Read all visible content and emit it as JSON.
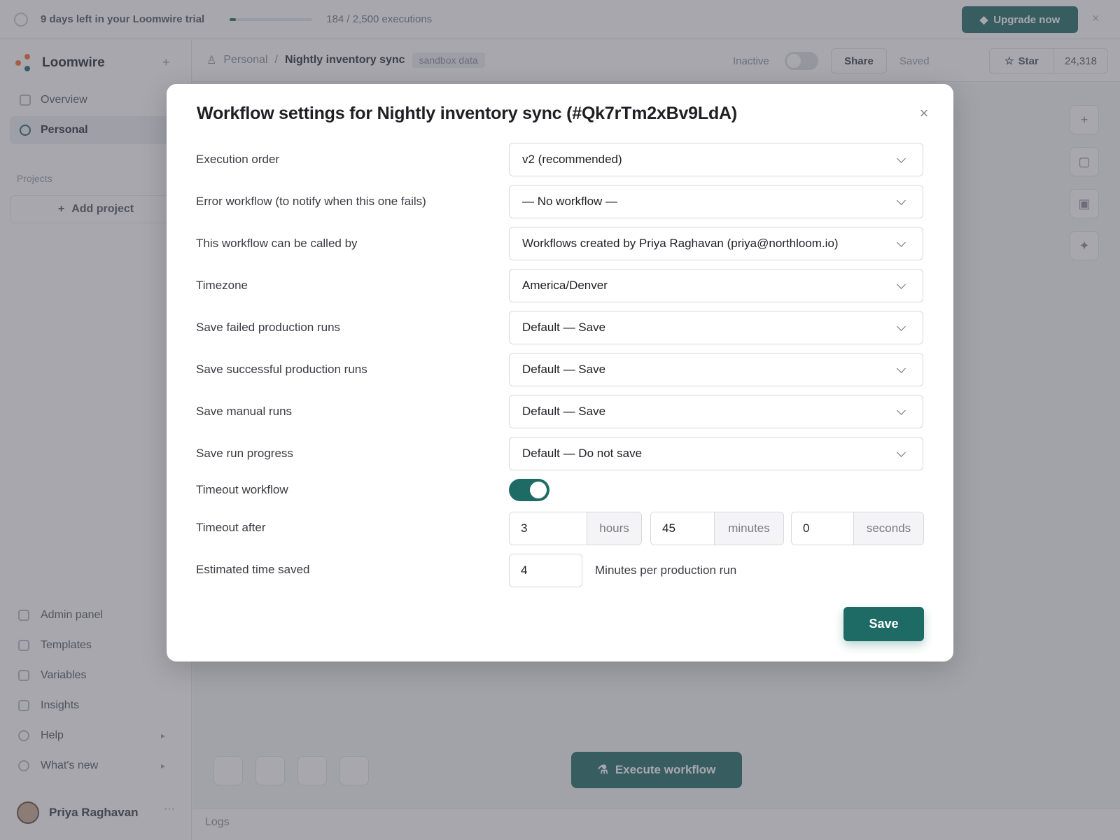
{
  "trial": {
    "text": "9 days left in your Loomwire trial",
    "executions": "184 / 2,500 executions",
    "progress_fraction": 0.074,
    "upgrade_label": "Upgrade now"
  },
  "sidebar": {
    "brand": "Loomwire",
    "nav": [
      {
        "label": "Overview"
      },
      {
        "label": "Personal",
        "active": true
      }
    ],
    "projects_label": "Projects",
    "add_project": "Add project",
    "bottom": [
      {
        "label": "Admin panel"
      },
      {
        "label": "Templates"
      },
      {
        "label": "Variables"
      },
      {
        "label": "Insights"
      },
      {
        "label": "Help"
      },
      {
        "label": "What's new"
      }
    ],
    "user_name": "Priya Raghavan"
  },
  "topbar": {
    "crumb_project": "Personal",
    "workflow_name": "Nightly inventory sync",
    "tag": "sandbox data",
    "status_label": "Inactive",
    "share_label": "Share",
    "saved_label": "Saved",
    "star_label": "Star",
    "star_count": "24,318"
  },
  "canvas": {
    "execute_label": "Execute workflow",
    "logs_label": "Logs"
  },
  "modal": {
    "title": "Workflow settings for Nightly inventory sync (#Qk7rTm2xBv9LdA)",
    "fields": [
      {
        "label": "Execution order",
        "value": "v2 (recommended)"
      },
      {
        "label": "Error workflow (to notify when this one fails)",
        "value": "— No workflow —"
      },
      {
        "label": "This workflow can be called by",
        "value": "Workflows created by Priya Raghavan (priya@northloom.io)"
      },
      {
        "label": "Timezone",
        "value": "America/Denver"
      },
      {
        "label": "Save failed production runs",
        "value": "Default — Save"
      },
      {
        "label": "Save successful production runs",
        "value": "Default — Save"
      },
      {
        "label": "Save manual runs",
        "value": "Default — Save"
      },
      {
        "label": "Save run progress",
        "value": "Default — Do not save"
      }
    ],
    "timeout_toggle_label": "Timeout workflow",
    "timeout_enabled": true,
    "timeout_after_label": "Timeout after",
    "timeout": {
      "hours": "3",
      "hours_unit": "hours",
      "minutes": "45",
      "minutes_unit": "minutes",
      "seconds": "0",
      "seconds_unit": "seconds"
    },
    "estimated_label": "Estimated time saved",
    "estimated_value": "4",
    "estimated_suffix": "Minutes per production run",
    "save_label": "Save"
  },
  "colors": {
    "accent": "#1e6b66",
    "brand_logo": "#ff6a2f"
  }
}
